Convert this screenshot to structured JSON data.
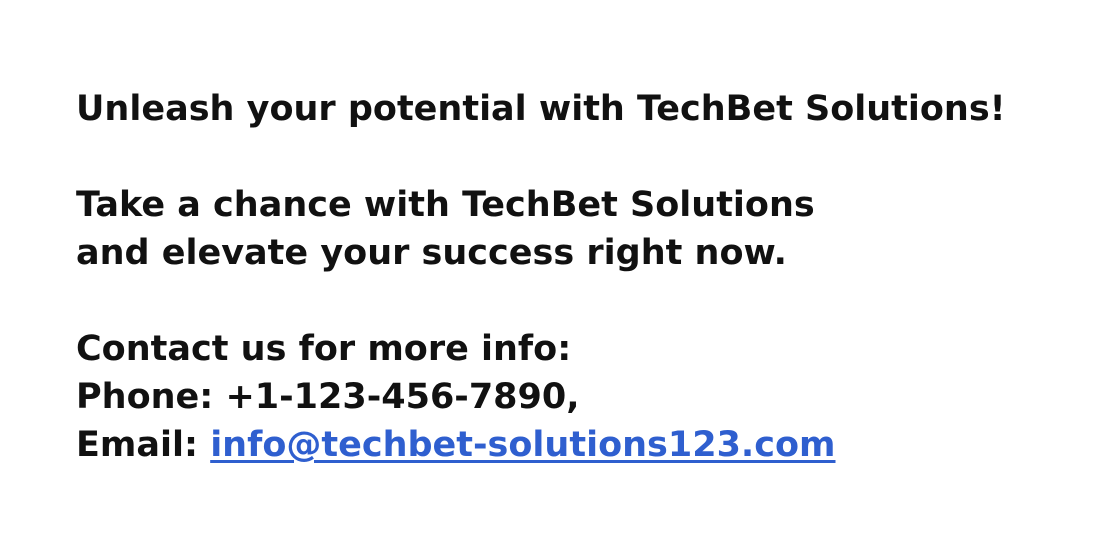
{
  "headline": "Unleash your potential with TechBet Solutions!",
  "promo": {
    "line1": "Take a chance with TechBet Solutions",
    "line2": "and elevate your success right now."
  },
  "contact": {
    "heading": "Contact us for more info:",
    "phone_line": "Phone: +1-123-456-7890,",
    "email_label": "Email: ",
    "email_address": "info@techbet-solutions123.com",
    "email_href": "mailto:info@techbet-solutions123.com"
  },
  "colors": {
    "text": "#111111",
    "link": "#2f5fcf",
    "background": "#ffffff"
  }
}
